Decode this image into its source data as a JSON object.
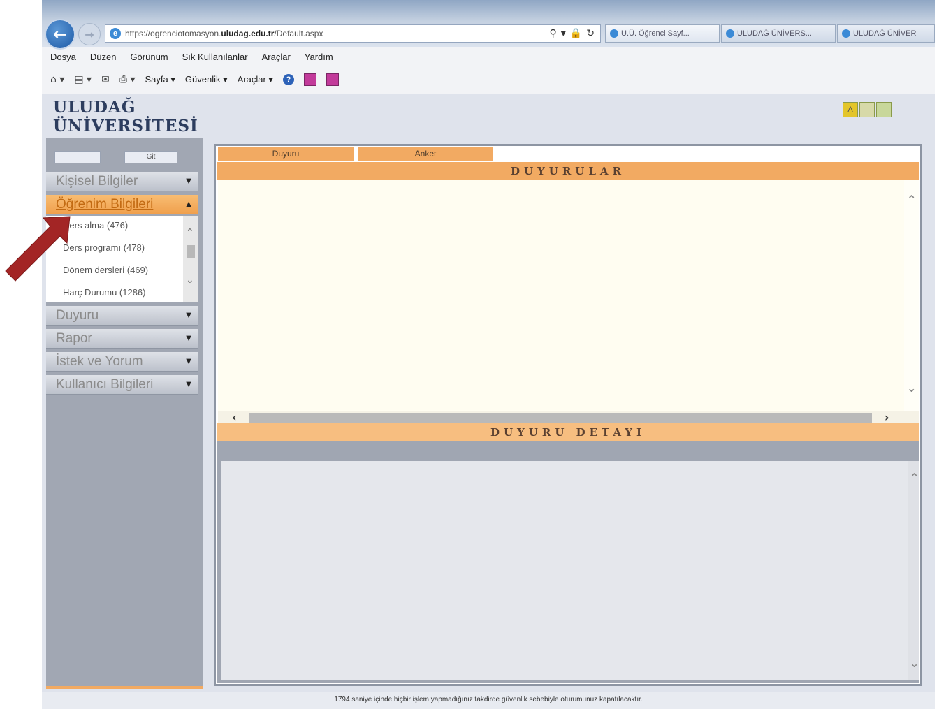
{
  "browser": {
    "url_prefix": "https://ogrenciotomasyon.",
    "url_domain": "uludag.edu.tr",
    "url_suffix": "/Default.aspx",
    "tabs": [
      {
        "label": "U.Ü. Öğrenci Sayf..."
      },
      {
        "label": "ULUDAĞ ÜNİVERS..."
      },
      {
        "label": "ULUDAĞ ÜNİVER"
      }
    ],
    "menu": [
      "Dosya",
      "Düzen",
      "Görünüm",
      "Sık Kullanılanlar",
      "Araçlar",
      "Yardım"
    ],
    "commands": {
      "page": "Sayfa ▾",
      "security": "Güvenlik ▾",
      "tools": "Araçlar ▾"
    }
  },
  "site": {
    "logo_line1": "ULUDAĞ",
    "logo_line2": "ÜNİVERSİTESİ",
    "window_buttons": [
      "A",
      "",
      ""
    ]
  },
  "sidebar": {
    "go_label": "Git",
    "sections": [
      {
        "label": "Kişisel Bilgiler"
      },
      {
        "label": "Öğrenim Bilgileri"
      },
      {
        "label": "Duyuru"
      },
      {
        "label": "Rapor"
      },
      {
        "label": "İstek ve Yorum"
      },
      {
        "label": "Kullanıcı Bilgileri"
      }
    ],
    "submenu": [
      {
        "label": "Ders alma (476)"
      },
      {
        "label": "Ders programı (478)"
      },
      {
        "label": "Dönem dersleri (469)"
      },
      {
        "label": "Harç Durumu (1286)"
      }
    ]
  },
  "main": {
    "tabs": [
      {
        "label": "Duyuru"
      },
      {
        "label": "Anket"
      }
    ],
    "announcements_header": "DUYURULAR",
    "detail_header": "DUYURU DETAYI"
  },
  "footer": {
    "counter": "1794",
    "text": "saniye içinde hiçbir işlem yapmadığınız takdirde güvenlik sebebiyle oturumunuz kapatılacaktır."
  },
  "colors": {
    "accent_orange": "#f2aa62",
    "sidebar_gray": "#a1a7b3",
    "arrow_red": "#a32525"
  }
}
